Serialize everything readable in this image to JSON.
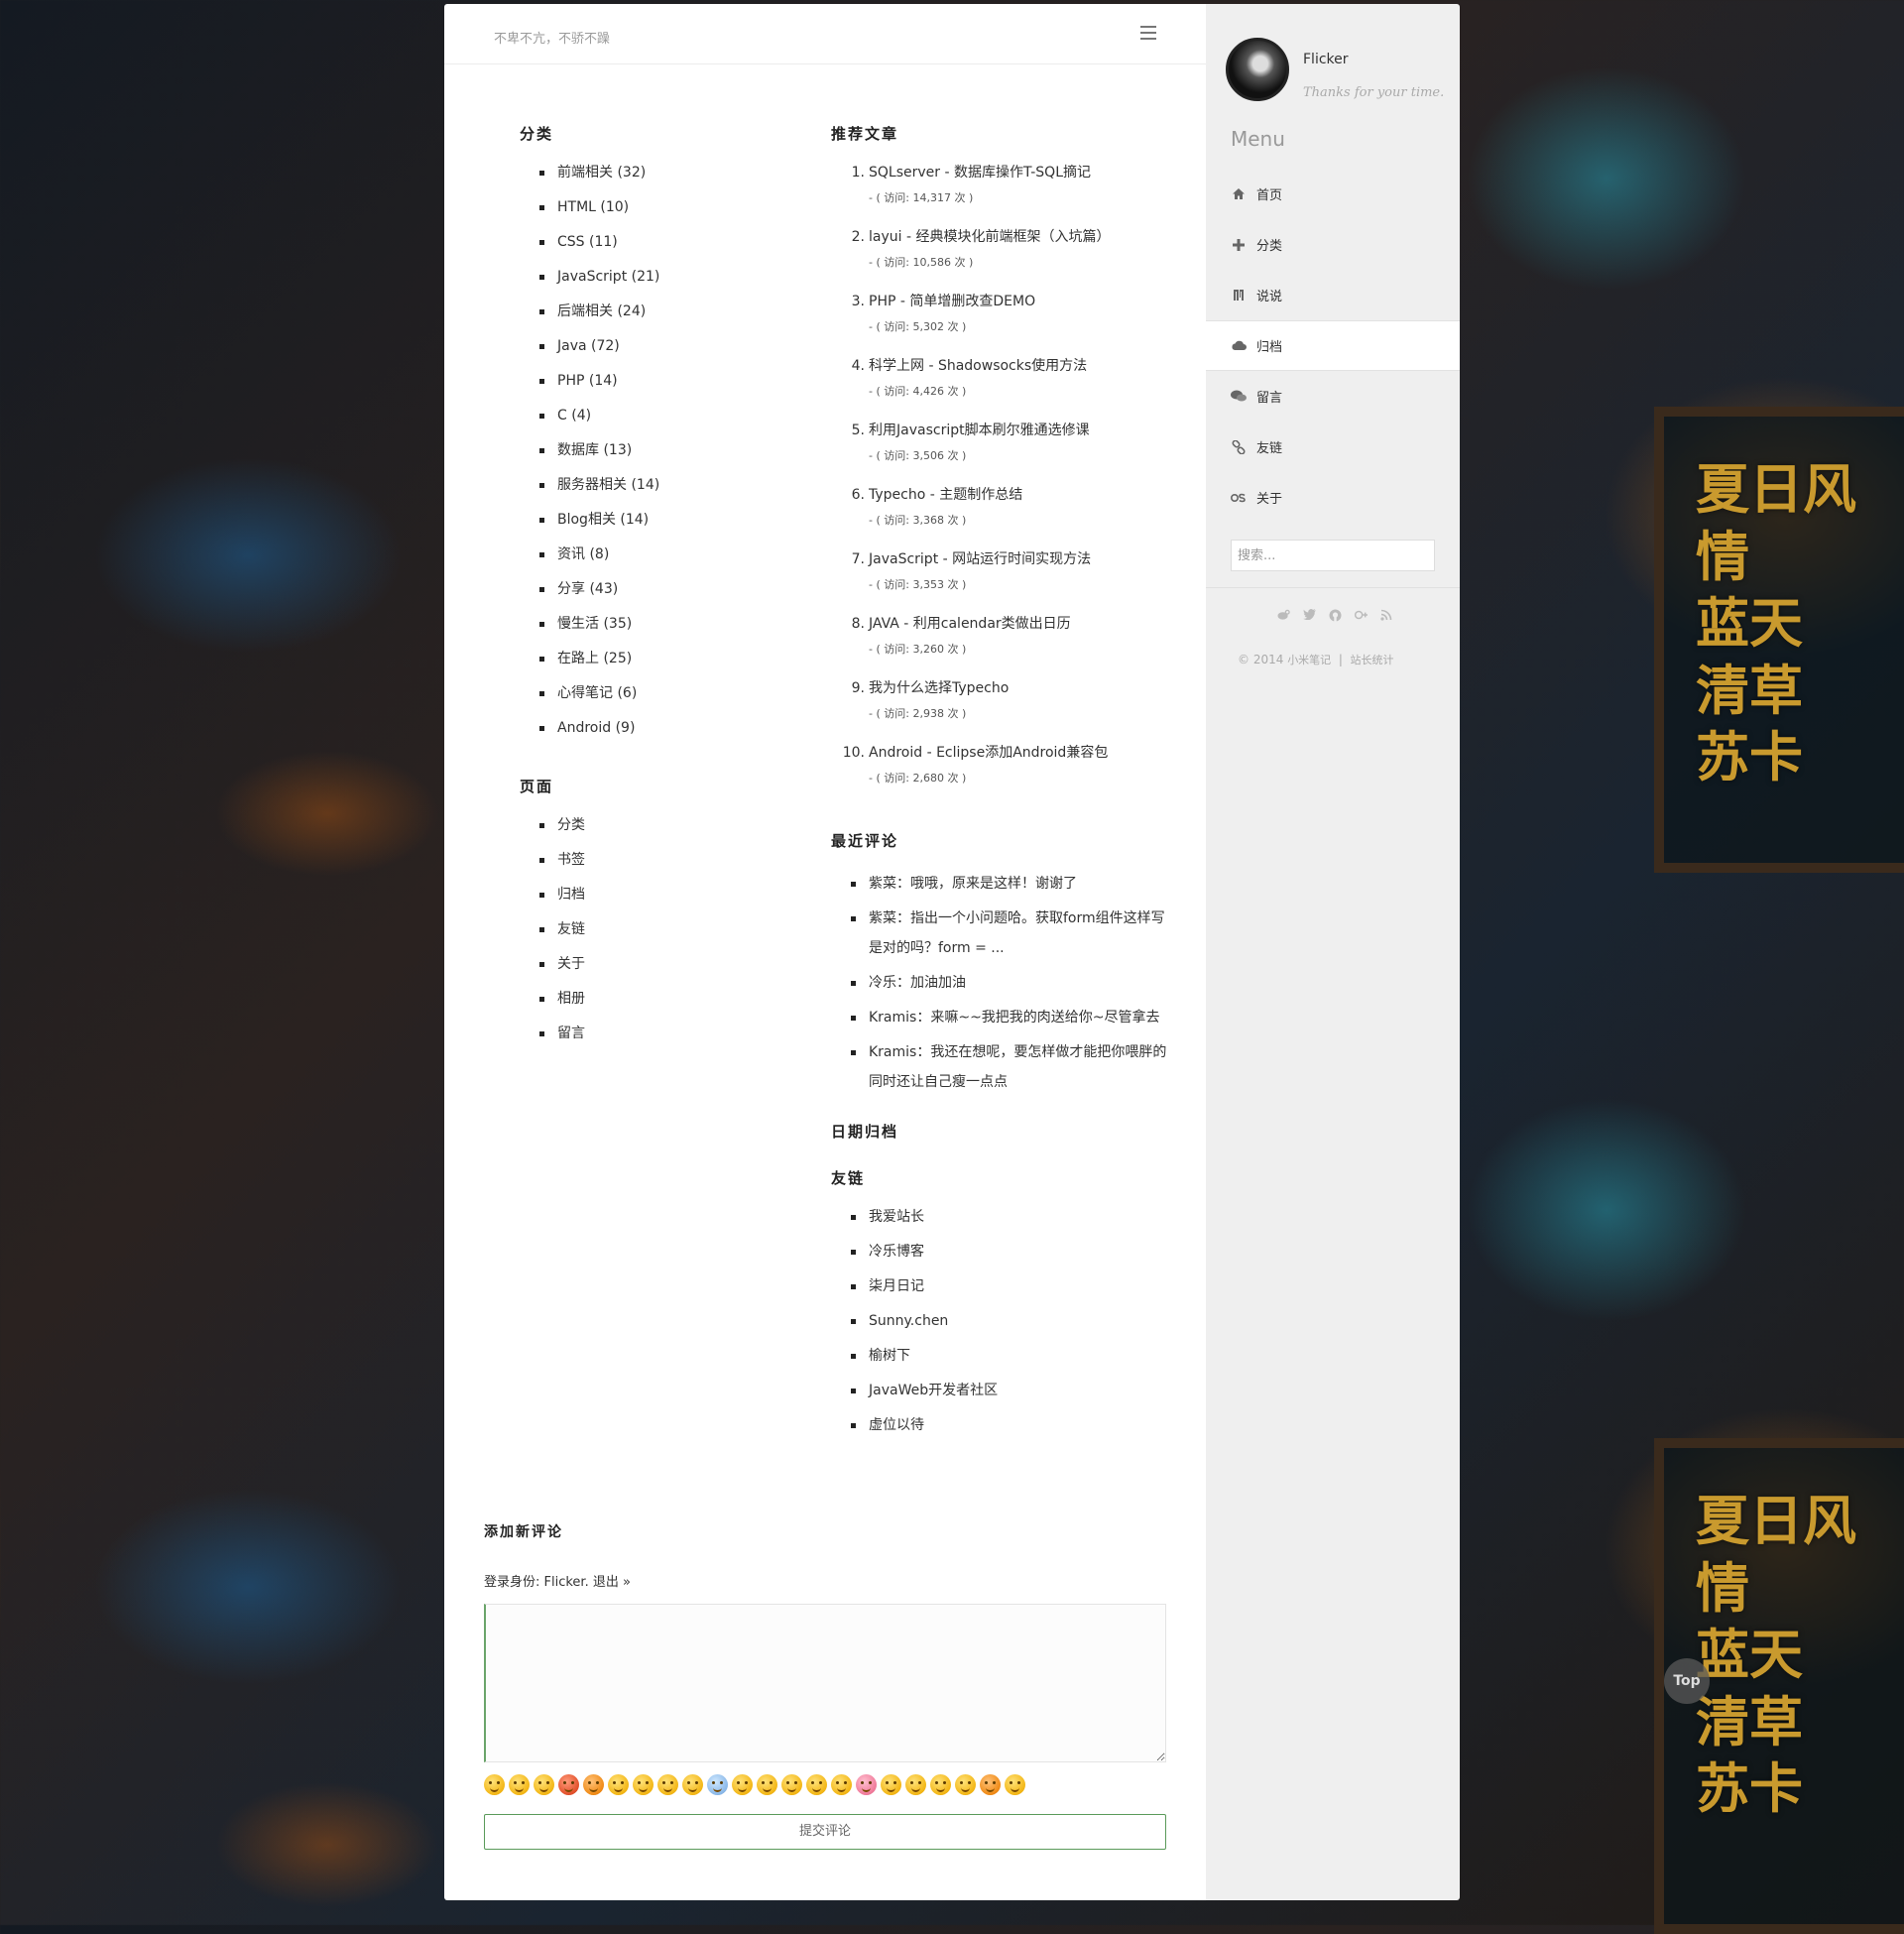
{
  "header": {
    "tagline": "不卑不亢，不骄不躁"
  },
  "categories": {
    "title": "分类",
    "items": [
      "前端相关 (32)",
      "HTML (10)",
      "CSS (11)",
      "JavaScript (21)",
      "后端相关 (24)",
      "Java (72)",
      "PHP (14)",
      "C (4)",
      "数据库 (13)",
      "服务器相关 (14)",
      "Blog相关 (14)",
      "资讯 (8)",
      "分享 (43)",
      "慢生活 (35)",
      "在路上 (25)",
      "心得笔记 (6)",
      "Android (9)"
    ]
  },
  "pages": {
    "title": "页面",
    "items": [
      "分类",
      "书签",
      "归档",
      "友链",
      "关于",
      "相册",
      "留言"
    ]
  },
  "recommended": {
    "title": "推荐文章",
    "items": [
      {
        "num": "1.",
        "title": "SQLserver - 数据库操作T-SQL摘记",
        "views": "- ( 访问: 14,317 次 )"
      },
      {
        "num": "2.",
        "title": "layui - 经典模块化前端框架（入坑篇）",
        "views": "- ( 访问: 10,586 次 )"
      },
      {
        "num": "3.",
        "title": "PHP - 简单增删改查DEMO",
        "views": "- ( 访问: 5,302 次 )"
      },
      {
        "num": "4.",
        "title": "科学上网 - Shadowsocks使用方法",
        "views": "- ( 访问: 4,426 次 )"
      },
      {
        "num": "5.",
        "title": "利用Javascript脚本刷尔雅通选修课",
        "views": "- ( 访问: 3,506 次 )"
      },
      {
        "num": "6.",
        "title": "Typecho - 主题制作总结",
        "views": "- ( 访问: 3,368 次 )"
      },
      {
        "num": "7.",
        "title": "JavaScript - 网站运行时间实现方法",
        "views": "- ( 访问: 3,353 次 )"
      },
      {
        "num": "8.",
        "title": "JAVA - 利用calendar类做出日历",
        "views": "- ( 访问: 3,260 次 )"
      },
      {
        "num": "9.",
        "title": "我为什么选择Typecho",
        "views": "- ( 访问: 2,938 次 )"
      },
      {
        "num": "10.",
        "title": "Android - Eclipse添加Android兼容包",
        "views": "- ( 访问: 2,680 次 )"
      }
    ]
  },
  "recent_comments": {
    "title": "最近评论",
    "items": [
      {
        "author": "紫菜",
        "text": "：哦哦，原来是这样！谢谢了"
      },
      {
        "author": "紫菜",
        "text": "：指出一个小问题哈。获取form组件这样写是对的吗？form = ..."
      },
      {
        "author": "冷乐",
        "text": "：加油加油"
      },
      {
        "author": "Kramis",
        "text": "：来嘛~~我把我的肉送给你~尽管拿去"
      },
      {
        "author": "Kramis",
        "text": "：我还在想呢，要怎样做才能把你喂胖的同时还让自己瘦一点点"
      }
    ]
  },
  "date_archive": {
    "title": "日期归档"
  },
  "friend_links": {
    "title": "友链",
    "items": [
      "我爱站长",
      "冷乐博客",
      "柒月日记",
      "Sunny.chen",
      "榆树下",
      "JavaWeb开发者社区",
      "虚位以待"
    ]
  },
  "comment_form": {
    "title": "添加新评论",
    "login_prefix": "登录身份: ",
    "login_user": "Flicker",
    "login_sep": ". ",
    "logout": "退出 »",
    "submit": "提交评论"
  },
  "sidebar": {
    "author": "Flicker",
    "motto": "Thanks for your time.",
    "menu_title": "Menu",
    "nav": [
      {
        "label": "首页",
        "icon": "home-icon"
      },
      {
        "label": "分类",
        "icon": "plus-icon"
      },
      {
        "label": "说说",
        "icon": "quote-icon"
      },
      {
        "label": "归档",
        "icon": "cloud-icon",
        "active": true
      },
      {
        "label": "留言",
        "icon": "chat-icon"
      },
      {
        "label": "友链",
        "icon": "link-icon"
      },
      {
        "label": "关于",
        "icon": "os-icon"
      }
    ],
    "search_placeholder": "搜索...",
    "social_icons": [
      "weibo-icon",
      "twitter-icon",
      "github-icon",
      "google-plus-icon",
      "rss-icon"
    ],
    "copyright": "© 2014",
    "site_name": "小米笔记",
    "separator": "|",
    "stats": "站长统计"
  },
  "back_to_top": "Top",
  "background_text": [
    "夏日风情",
    "蓝天",
    "清草",
    "苏卡"
  ],
  "colors": {
    "accent_green": "#5a9a5a",
    "sidebar_bg": "#efefef"
  }
}
